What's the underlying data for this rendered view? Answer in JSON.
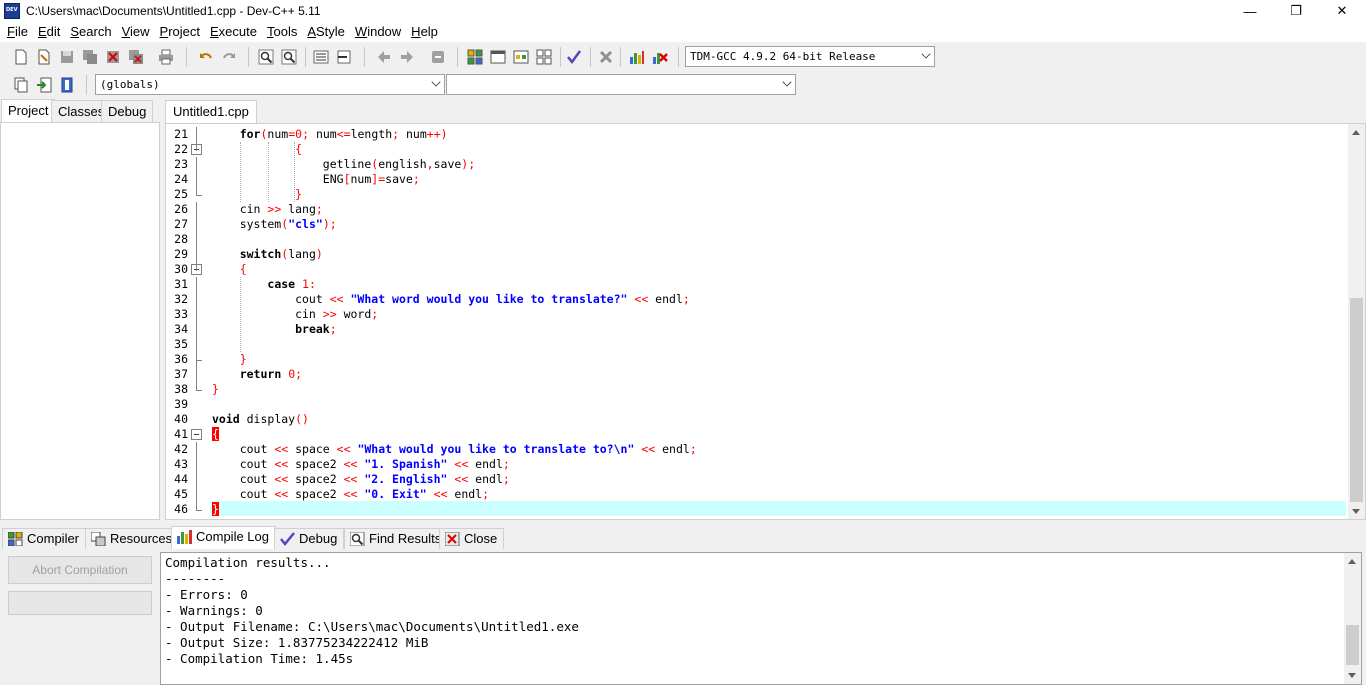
{
  "window": {
    "title": "C:\\Users\\mac\\Documents\\Untitled1.cpp - Dev-C++ 5.11",
    "minimize": "—",
    "maximize": "❐",
    "close": "✕"
  },
  "menu": [
    {
      "u": "F",
      "rest": "ile"
    },
    {
      "u": "E",
      "rest": "dit"
    },
    {
      "u": "S",
      "rest": "earch"
    },
    {
      "u": "V",
      "rest": "iew"
    },
    {
      "u": "P",
      "rest": "roject"
    },
    {
      "u": "E",
      "rest": "xecute"
    },
    {
      "u": "T",
      "rest": "ools"
    },
    {
      "u": "A",
      "rest": "Style"
    },
    {
      "u": "W",
      "rest": "indow"
    },
    {
      "u": "H",
      "rest": "elp"
    }
  ],
  "toolbar": {
    "compiler_select": "TDM-GCC 4.9.2 64-bit Release",
    "scope_select": "(globals)",
    "function_select": ""
  },
  "left_tabs": [
    "Project",
    "Classes",
    "Debug"
  ],
  "editor_tab": "Untitled1.cpp",
  "code_lines": [
    {
      "n": "21",
      "html": "    <span class=\"kw\">for</span><span class=\"sym\">(</span>num<span class=\"sym\">=</span><span class=\"num\">0</span><span class=\"sym\">;</span> num<span class=\"sym\">&lt;=</span>length<span class=\"sym\">;</span> num<span class=\"sym\">++)</span>"
    },
    {
      "n": "22",
      "html": "            <span class=\"sym\">{</span>"
    },
    {
      "n": "23",
      "html": "                getline<span class=\"sym\">(</span>english<span class=\"sym\">,</span>save<span class=\"sym\">);</span>"
    },
    {
      "n": "24",
      "html": "                ENG<span class=\"sym\">[</span>num<span class=\"sym\">]=</span>save<span class=\"sym\">;</span>"
    },
    {
      "n": "25",
      "html": "            <span class=\"sym\">}</span>"
    },
    {
      "n": "26",
      "html": "    cin <span class=\"sym\">&gt;&gt;</span> lang<span class=\"sym\">;</span>"
    },
    {
      "n": "27",
      "html": "    system<span class=\"sym\">(</span><span class=\"str\">\"cls\"</span><span class=\"sym\">);</span>"
    },
    {
      "n": "28",
      "html": ""
    },
    {
      "n": "29",
      "html": "    <span class=\"kw\">switch</span><span class=\"sym\">(</span>lang<span class=\"sym\">)</span>"
    },
    {
      "n": "30",
      "html": "    <span class=\"sym\">{</span>"
    },
    {
      "n": "31",
      "html": "        <span class=\"kw\">case</span> <span class=\"num\">1</span><span class=\"sym\">:</span>"
    },
    {
      "n": "32",
      "html": "            cout <span class=\"sym\">&lt;&lt;</span> <span class=\"str\">\"What word would you like to translate?\"</span> <span class=\"sym\">&lt;&lt;</span> endl<span class=\"sym\">;</span>"
    },
    {
      "n": "33",
      "html": "            cin <span class=\"sym\">&gt;&gt;</span> word<span class=\"sym\">;</span>"
    },
    {
      "n": "34",
      "html": "            <span class=\"kw\">break</span><span class=\"sym\">;</span>"
    },
    {
      "n": "35",
      "html": ""
    },
    {
      "n": "36",
      "html": "    <span class=\"sym\">}</span>"
    },
    {
      "n": "37",
      "html": "    <span class=\"kw\">return</span> <span class=\"num\">0</span><span class=\"sym\">;</span>"
    },
    {
      "n": "38",
      "html": "<span class=\"sym\">}</span>"
    },
    {
      "n": "39",
      "html": ""
    },
    {
      "n": "40",
      "html": "<span class=\"kw\">void</span> display<span class=\"sym\">()</span>"
    },
    {
      "n": "41",
      "html": "<span class=\"brace-hl\">{</span>"
    },
    {
      "n": "42",
      "html": "    cout <span class=\"sym\">&lt;&lt;</span> space <span class=\"sym\">&lt;&lt;</span> <span class=\"str\">\"What would you like to translate to?\\n\"</span> <span class=\"sym\">&lt;&lt;</span> endl<span class=\"sym\">;</span>"
    },
    {
      "n": "43",
      "html": "    cout <span class=\"sym\">&lt;&lt;</span> space2 <span class=\"sym\">&lt;&lt;</span> <span class=\"str\">\"1. Spanish\"</span> <span class=\"sym\">&lt;&lt;</span> endl<span class=\"sym\">;</span>"
    },
    {
      "n": "44",
      "html": "    cout <span class=\"sym\">&lt;&lt;</span> space2 <span class=\"sym\">&lt;&lt;</span> <span class=\"str\">\"2. English\"</span> <span class=\"sym\">&lt;&lt;</span> endl<span class=\"sym\">;</span>"
    },
    {
      "n": "45",
      "html": "    cout <span class=\"sym\">&lt;&lt;</span> space2 <span class=\"sym\">&lt;&lt;</span> <span class=\"str\">\"0. Exit\"</span> <span class=\"sym\">&lt;&lt;</span> endl<span class=\"sym\">;</span>"
    },
    {
      "n": "46",
      "html": "<span class=\"brace-hl\">}</span>"
    }
  ],
  "bottom_tabs": [
    {
      "label": "Compiler",
      "icon": "compiler-icon"
    },
    {
      "label": "Resources",
      "icon": "resources-icon"
    },
    {
      "label": "Compile Log",
      "icon": "chart-icon"
    },
    {
      "label": "Debug",
      "icon": "check-icon"
    },
    {
      "label": "Find Results",
      "icon": "find-icon"
    },
    {
      "label": "Close",
      "icon": "close-icon"
    }
  ],
  "abort_button": "Abort Compilation",
  "compile_log": [
    "Compilation results...",
    "--------",
    "- Errors: 0",
    "- Warnings: 0",
    "- Output Filename: C:\\Users\\mac\\Documents\\Untitled1.exe",
    "- Output Size: 1.83775234222412 MiB",
    "- Compilation Time: 1.45s"
  ],
  "colors": {
    "keyword": "#000000",
    "symbol": "#ff0000",
    "string": "#0000ff",
    "active_line": "#ccffff"
  }
}
